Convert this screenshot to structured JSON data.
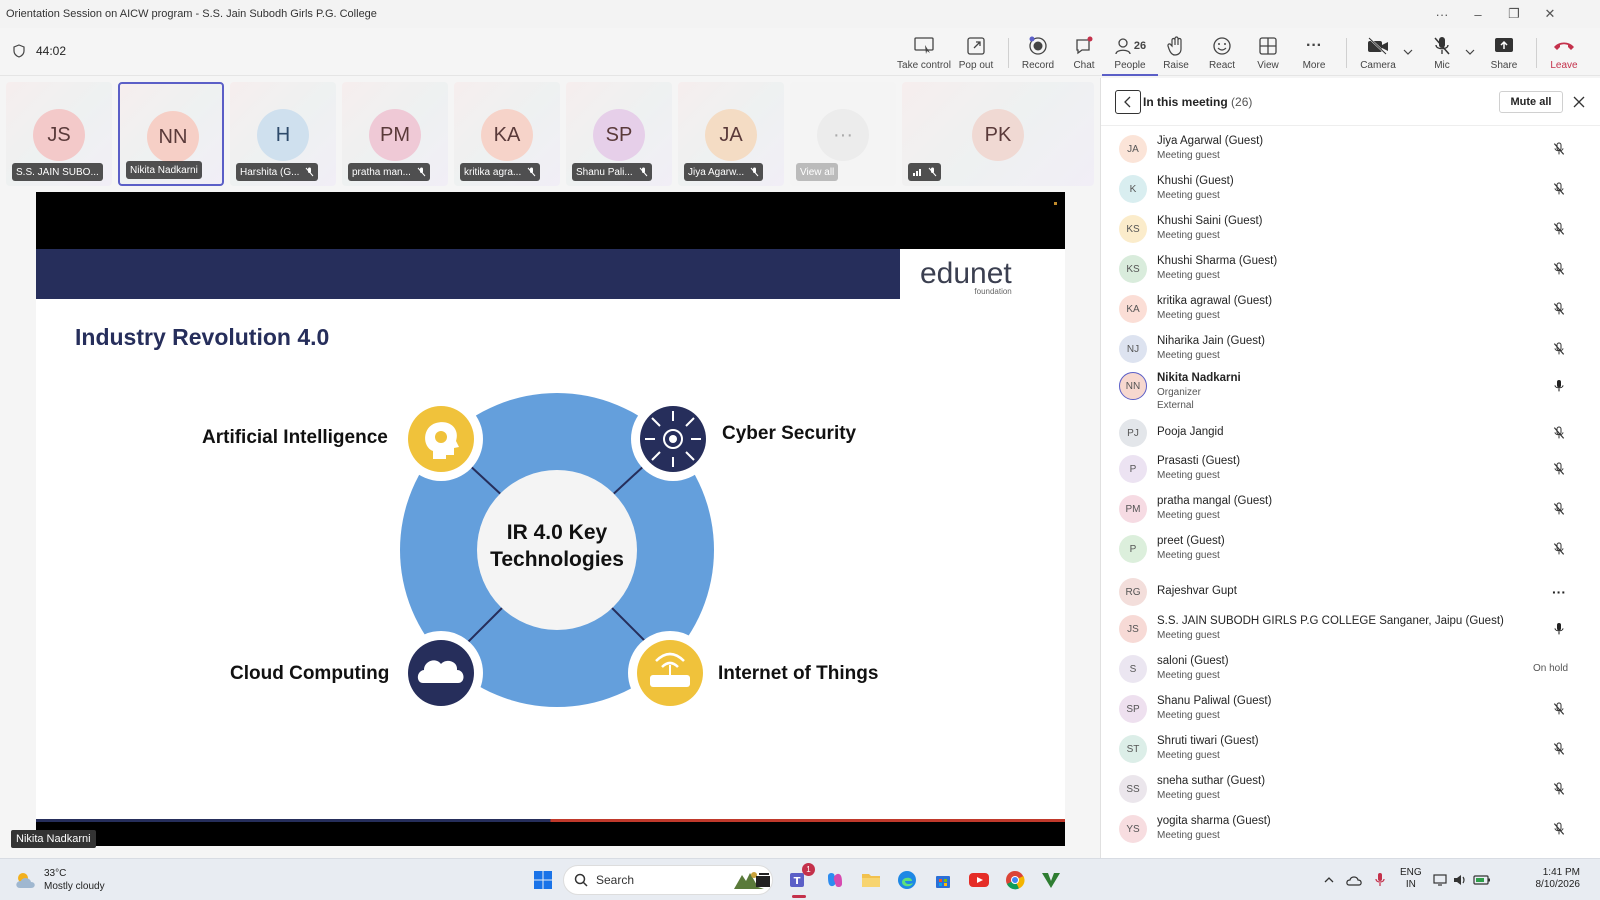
{
  "window": {
    "title": "Orientation Session on AICW program - S.S. Jain Subodh Girls P.G. College"
  },
  "meeting": {
    "timer": "44:02"
  },
  "toolbar": {
    "take_control": "Take control",
    "pop_out": "Pop out",
    "record": "Record",
    "chat": "Chat",
    "people": "People",
    "people_count": "26",
    "raise": "Raise",
    "react": "React",
    "view": "View",
    "more": "More",
    "camera": "Camera",
    "mic": "Mic",
    "share": "Share",
    "leave": "Leave"
  },
  "tiles": [
    {
      "initials": "JS",
      "name": "S.S. JAIN SUBO...",
      "color": "#f3c9c9"
    },
    {
      "initials": "NN",
      "name": "Nikita Nadkarni",
      "color": "#f6cfc6"
    },
    {
      "initials": "H",
      "name": "Harshita (G...",
      "color": "#cfe0ee"
    },
    {
      "initials": "PM",
      "name": "pratha man...",
      "color": "#efc9d6"
    },
    {
      "initials": "KA",
      "name": "kritika agra...",
      "color": "#f6d3c9"
    },
    {
      "initials": "SP",
      "name": "Shanu Pali...",
      "color": "#e6cfe9"
    },
    {
      "initials": "JA",
      "name": "Jiya Agarw...",
      "color": "#f4dcc4"
    },
    {
      "initials": "···",
      "name": "View all",
      "color": "#ececec"
    },
    {
      "initials": "PK",
      "name": "",
      "color": "#f0d9d3"
    }
  ],
  "slide": {
    "logo_main": "edunet",
    "logo_sub": "foundation",
    "title": "Industry Revolution 4.0",
    "center_text_1": "IR 4.0 Key",
    "center_text_2": "Technologies",
    "labels": {
      "ai": "Artificial Intelligence",
      "cyber": "Cyber Security",
      "cloud": "Cloud Computing",
      "iot": "Internet of Things"
    },
    "colors": {
      "ring": "#649fdc",
      "navy": "#262e5b",
      "gold": "#f0c23b"
    }
  },
  "speaker_label": "Nikita Nadkarni",
  "panel": {
    "title": "In this meeting",
    "count": "(26)",
    "mute_all": "Mute all",
    "participants": [
      {
        "initials": "JA",
        "name": "Jiya Agarwal (Guest)",
        "role": "Meeting guest",
        "role2": "",
        "status": "mic-off",
        "color": "#fbe4d8"
      },
      {
        "initials": "K",
        "name": "Khushi (Guest)",
        "role": "Meeting guest",
        "role2": "",
        "status": "mic-off",
        "color": "#d9eef0"
      },
      {
        "initials": "KS",
        "name": "Khushi Saini (Guest)",
        "role": "Meeting guest",
        "role2": "",
        "status": "mic-off",
        "color": "#fbeccb"
      },
      {
        "initials": "KS",
        "name": "Khushi Sharma (Guest)",
        "role": "Meeting guest",
        "role2": "",
        "status": "mic-off",
        "color": "#d9ecdc"
      },
      {
        "initials": "KA",
        "name": "kritika agrawal (Guest)",
        "role": "Meeting guest",
        "role2": "",
        "status": "mic-off",
        "color": "#fbded6"
      },
      {
        "initials": "NJ",
        "name": "Niharika Jain (Guest)",
        "role": "Meeting guest",
        "role2": "",
        "status": "mic-off",
        "color": "#dde3f0"
      },
      {
        "initials": "NN",
        "name": "Nikita Nadkarni",
        "role": "Organizer",
        "role2": "External",
        "status": "mic-on",
        "color": "#f7d8cf"
      },
      {
        "initials": "PJ",
        "name": "Pooja Jangid",
        "role": "",
        "role2": "",
        "status": "mic-off",
        "color": "#e3e6ea"
      },
      {
        "initials": "P",
        "name": "Prasasti (Guest)",
        "role": "Meeting guest",
        "role2": "",
        "status": "mic-off",
        "color": "#ece3f2"
      },
      {
        "initials": "PM",
        "name": "pratha mangal (Guest)",
        "role": "Meeting guest",
        "role2": "",
        "status": "mic-off",
        "color": "#f6dbe3"
      },
      {
        "initials": "P",
        "name": "preet (Guest)",
        "role": "Meeting guest",
        "role2": "",
        "status": "mic-off",
        "color": "#dcefdc"
      },
      {
        "initials": "RG",
        "name": "Rajeshvar Gupt",
        "role": "",
        "role2": "",
        "status": "more",
        "color": "#f3dedb"
      },
      {
        "initials": "JS",
        "name": "S.S. JAIN SUBODH GIRLS P.G COLLEGE Sanganer, Jaipu (Guest)",
        "role": "Meeting guest",
        "role2": "",
        "status": "mic-on",
        "color": "#f7dad6"
      },
      {
        "initials": "S",
        "name": "saloni (Guest)",
        "role": "Meeting guest",
        "role2": "",
        "status": "On hold",
        "color": "#ebe6f1"
      },
      {
        "initials": "SP",
        "name": "Shanu Paliwal (Guest)",
        "role": "Meeting guest",
        "role2": "",
        "status": "mic-off",
        "color": "#eee0ef"
      },
      {
        "initials": "ST",
        "name": "Shruti tiwari (Guest)",
        "role": "Meeting guest",
        "role2": "",
        "status": "mic-off",
        "color": "#dceee8"
      },
      {
        "initials": "SS",
        "name": "sneha suthar (Guest)",
        "role": "Meeting guest",
        "role2": "",
        "status": "mic-off",
        "color": "#ebe6ec"
      },
      {
        "initials": "YS",
        "name": "yogita sharma (Guest)",
        "role": "Meeting guest",
        "role2": "",
        "status": "mic-off",
        "color": "#f7dde0"
      }
    ]
  },
  "taskbar": {
    "temp": "33°C",
    "weather": "Mostly cloudy",
    "search": "Search",
    "teams_badge": "1",
    "lang1": "ENG",
    "lang2": "IN",
    "time": "1:41 PM",
    "date": "8/10/2026"
  }
}
